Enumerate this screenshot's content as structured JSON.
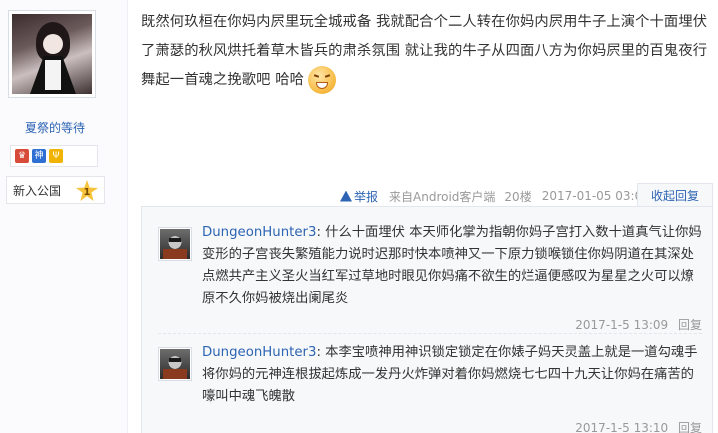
{
  "author": {
    "username": "夏祭的等待",
    "badges": [
      "神"
    ],
    "rank_label": "新入公国",
    "rank_level": "1"
  },
  "post": {
    "body": "既然何玖桓在你妈内屄里玩全城戒备 我就配合个二人转在你妈内屄用牛子上演个十面埋伏了萧瑟的秋风烘托着草木皆兵的肃杀氛围 就让我的牛子从四面八方为你妈屄里的百鬼夜行舞起一首魂之挽歌吧 哈哈",
    "emoji": "grin-emoji"
  },
  "meta": {
    "report_label": "举报",
    "source": "来自Android客户端",
    "floor": "20楼",
    "time": "2017-01-05 03:09",
    "fold_label": "收起回复"
  },
  "replies": [
    {
      "user": "DungeonHunter3",
      "sep": ":",
      "text": "什么十面埋伏 本天师化掌为指朝你妈子宫打入数十道真气让你妈变形的子宫丧失繁殖能力说时迟那时快本喷神又一下原力锁喉锁住你妈阴道在其深处点燃共产主义圣火当红军过草地时眼见你妈痛不欲生的烂逼便感叹为星星之火可以燎原不久你妈被烧出阑尾炎",
      "time": "2017-1-5 13:09",
      "reply_label": "回复"
    },
    {
      "user": "DungeonHunter3",
      "sep": ":",
      "text": "本李宝喷神用神识锁定锁定在你婊子妈天灵盖上就是一道勾魂手将你妈的元神连根拔起炼成一发丹火炸弹对着你妈燃烧七七四十九天让你妈在痛苦的嚎叫中魂飞魄散",
      "time": "2017-1-5 13:10",
      "reply_label": "回复"
    }
  ],
  "colors": {
    "link": "#2d64b3",
    "meta": "#999999",
    "reply_bg": "#f7f8fa"
  }
}
